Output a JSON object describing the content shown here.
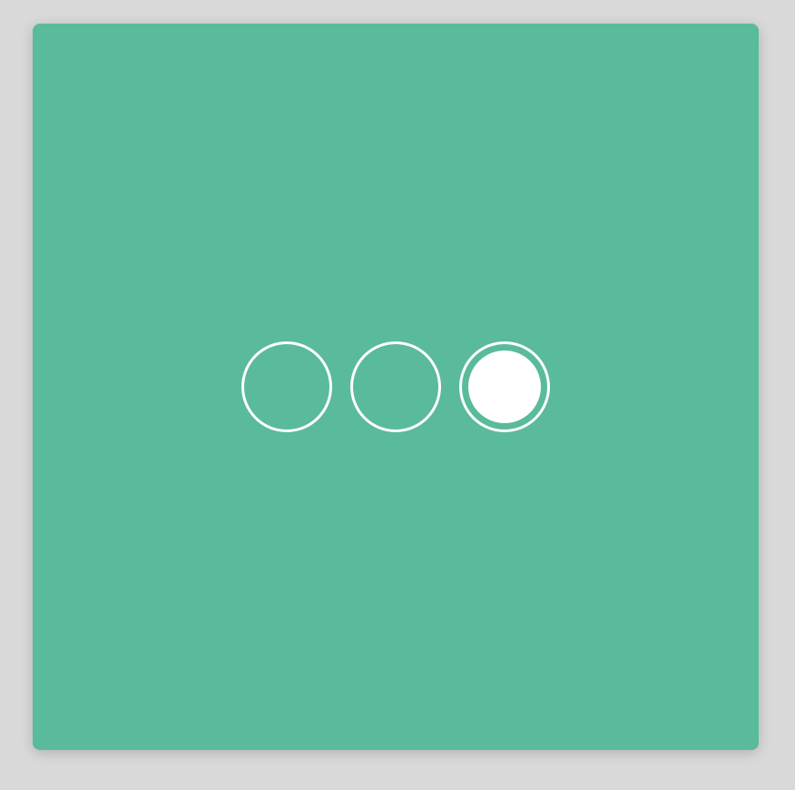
{
  "colors": {
    "page_background": "#d9d9d9",
    "card_background": "#5aba9c",
    "dot_color": "#ffffff"
  },
  "carousel": {
    "dots": [
      {
        "icon": "circle-outline-icon",
        "active": false
      },
      {
        "icon": "circle-outline-icon",
        "active": false
      },
      {
        "icon": "circle-filled-icon",
        "active": true
      }
    ],
    "active_index": 2
  }
}
